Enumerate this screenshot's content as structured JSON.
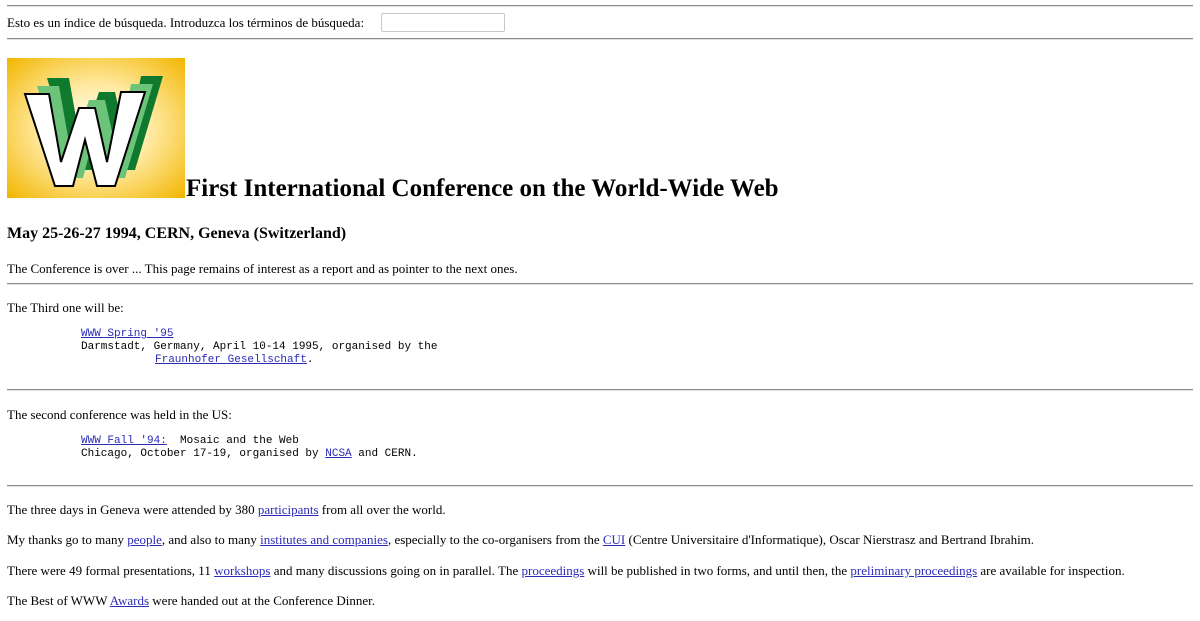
{
  "search": {
    "label": "Esto es un índice de búsqueda. Introduzca los términos de búsqueda:",
    "value": ""
  },
  "header": {
    "title": "First International Conference on the World-Wide Web",
    "subtitle": "May 25-26-27 1994, CERN, Geneva (Switzerland)"
  },
  "intro": "The Conference is over ... This page remains of interest as a report and as pointer to the next ones.",
  "third": {
    "lead": "The Third one will be:",
    "link": "WWW Spring '95",
    "line2": "Darmstadt, Germany, April 10-14 1995, organised by the",
    "org_link": "Fraunhofer Gesellschaft",
    "period": "."
  },
  "second": {
    "lead": "The second conference was held in the US:",
    "link": "WWW Fall '94:",
    "title_rest": "  Mosaic and the Web",
    "line2_a": "Chicago, October 17-19, organised by ",
    "ncsa_link": "NCSA",
    "line2_b": " and CERN."
  },
  "para1": {
    "a": "The three days in Geneva were attended by 380 ",
    "link": "participants",
    "b": " from all over the world."
  },
  "para2": {
    "a": "My thanks go to many ",
    "link1": "people",
    "b": ", and also to many ",
    "link2": "institutes and companies",
    "c": ", especially to the co-organisers from the ",
    "link3": "CUI",
    "d": " (Centre Universitaire d'Informatique), Oscar Nierstrasz and Bertrand Ibrahim."
  },
  "para3": {
    "a": "There were 49 formal presentations, 11 ",
    "link1": "workshops",
    "b": " and many discussions going on in parallel. The ",
    "link2": "proceedings",
    "c": " will be published in two forms, and until then, the ",
    "link3": "preliminary proceedings",
    "d": " are available for inspection."
  },
  "para4": {
    "a": "The Best of WWW ",
    "link": "Awards",
    "b": " were handed out at the Conference Dinner."
  },
  "colors": {
    "link": "#2b2bb8",
    "logo_bg_center": "#ffffff",
    "logo_bg_edge": "#f2b600",
    "logo_dark_green": "#0f7a2e",
    "logo_light_green": "#6cc47a"
  }
}
